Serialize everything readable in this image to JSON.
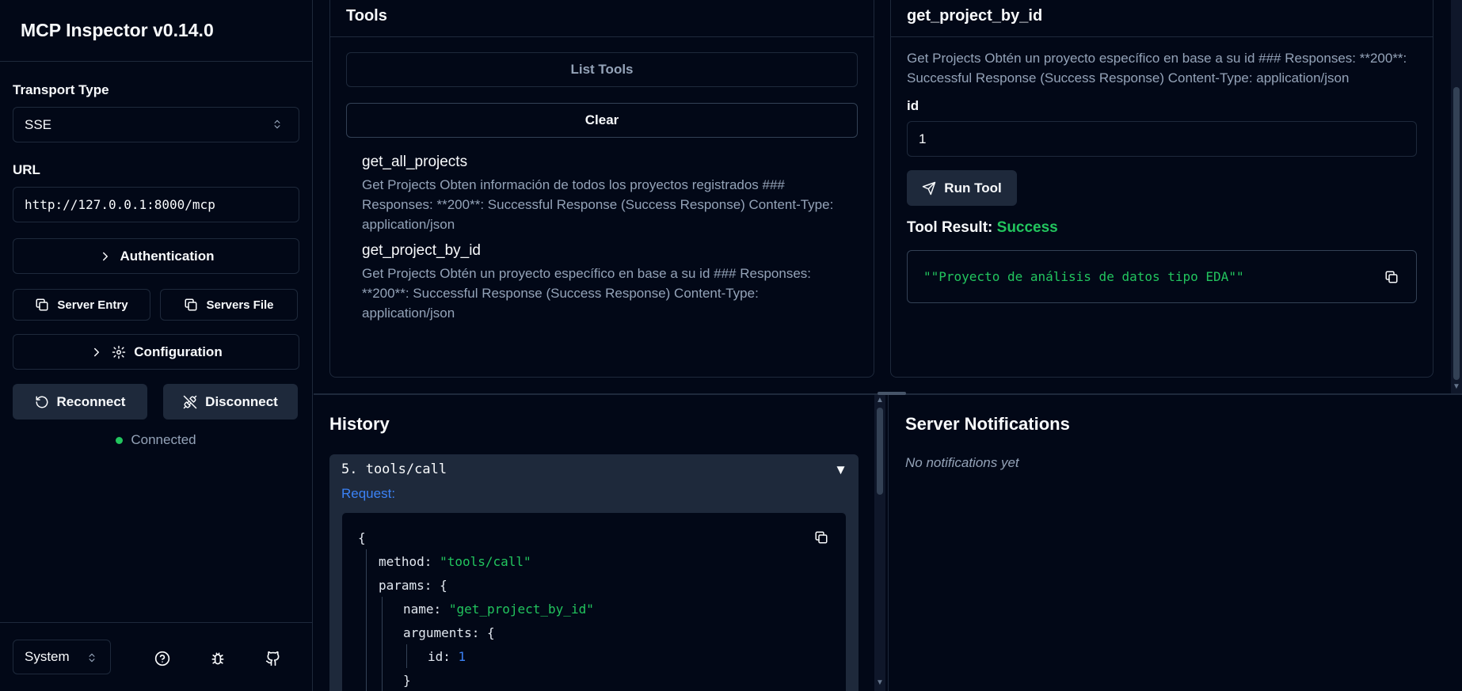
{
  "app": {
    "title": "MCP Inspector v0.14.0"
  },
  "sidebar": {
    "transport_label": "Transport Type",
    "transport_value": "SSE",
    "url_label": "URL",
    "url_value": "http://127.0.0.1:8000/mcp",
    "authentication_label": "Authentication",
    "server_entry_label": "Server Entry",
    "servers_file_label": "Servers File",
    "configuration_label": "Configuration",
    "reconnect_label": "Reconnect",
    "disconnect_label": "Disconnect",
    "status_text": "Connected",
    "status_color": "#22c55e",
    "theme_value": "System"
  },
  "tools": {
    "title": "Tools",
    "list_label": "List Tools",
    "clear_label": "Clear",
    "items": [
      {
        "name": "get_all_projects",
        "description": "Get Projects Obten información de todos los proyectos registrados ### Responses: **200**: Successful Response (Success Response) Content-Type: application/json"
      },
      {
        "name": "get_project_by_id",
        "description": "Get Projects Obtén un proyecto específico en base a su id ### Responses: **200**: Successful Response (Success Response) Content-Type: application/json"
      }
    ]
  },
  "detail": {
    "title": "get_project_by_id",
    "description": "Get Projects Obtén un proyecto específico en base a su id ### Responses: **200**: Successful Response (Success Response) Content-Type: application/json",
    "param_label": "id",
    "param_value": "1",
    "run_label": "Run Tool",
    "result_label": "Tool Result:",
    "result_status": "Success",
    "result_text": "\"\"Proyecto de análisis de datos tipo EDA\"\""
  },
  "history": {
    "title": "History",
    "entry_title": "5. tools/call",
    "request_label": "Request:",
    "json": {
      "open_brace": "{",
      "method_key": "method:",
      "method_val": "\"tools/call\"",
      "params_key": "params:",
      "params_brace": "{",
      "name_key": "name:",
      "name_val": "\"get_project_by_id\"",
      "arguments_key": "arguments:",
      "arguments_brace": "{",
      "id_key": "id:",
      "id_val": "1",
      "close_brace": "}"
    }
  },
  "notifications": {
    "title": "Server Notifications",
    "empty_text": "No notifications yet"
  }
}
